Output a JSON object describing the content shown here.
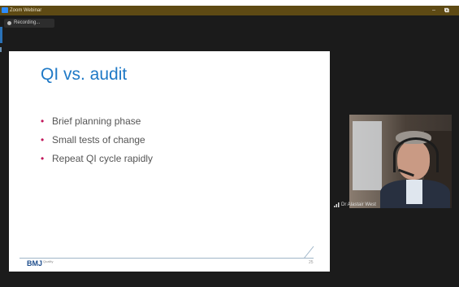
{
  "window": {
    "title": "Zoom Webinar",
    "minimize": "–",
    "maximize": "⧉"
  },
  "recording": {
    "label": "Recording..."
  },
  "slide": {
    "title": "QI vs. audit",
    "bullets": [
      "Brief planning phase",
      "Small tests of change",
      "Repeat QI cycle rapidly"
    ],
    "logo": "BMJ",
    "logo_sub": "Quality",
    "page_number": "25"
  },
  "video": {
    "participant_name": "Dr Alastair West"
  },
  "colors": {
    "title_bar": "#5e4a14",
    "background": "#1b1b1b",
    "slide_title": "#1f79c6",
    "bullet": "#c2185b",
    "bmj_blue": "#1f4e8c"
  },
  "icons": {
    "app": "zoom-logo-icon",
    "recording": "record-dot-icon",
    "signal": "signal-bars-icon"
  }
}
